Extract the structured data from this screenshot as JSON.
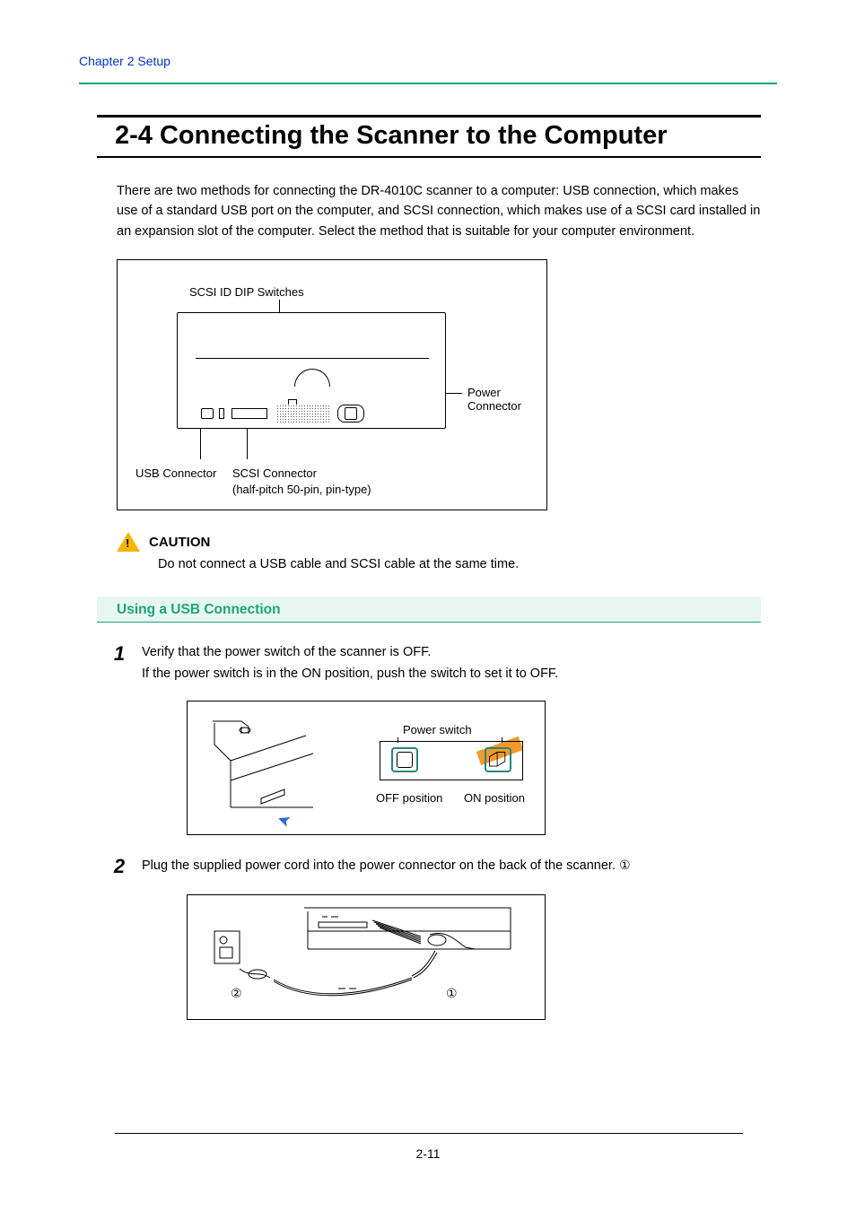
{
  "header": {
    "chapter_link": "Chapter 2   Setup"
  },
  "title": "2-4  Connecting the Scanner to the Computer",
  "intro": "There are two methods for connecting the DR-4010C scanner to a computer: USB connection, which makes use of a standard USB port on the computer, and SCSI connection, which makes use of a SCSI card installed in an expansion slot of the computer. Select the method that is suitable for your computer environment.",
  "figure1": {
    "scsi_dip_label": "SCSI ID DIP Switches",
    "power_connector_label": "Power Connector",
    "usb_connector_label": "USB Connector",
    "scsi_connector_label": "SCSI Connector",
    "scsi_connector_sub": "(half-pitch 50-pin, pin-type)"
  },
  "caution": {
    "title": "CAUTION",
    "text": "Do not connect a USB cable and SCSI cable at the same time."
  },
  "subheading": "Using a USB Connection",
  "steps": [
    {
      "num": "1",
      "line1": "Verify that the power switch of the scanner is OFF.",
      "line2": "If the power switch is in the ON position, push the switch to set it to OFF."
    },
    {
      "num": "2",
      "line1": "Plug the supplied power cord into the power connector on the back of the scanner. ",
      "ref": "①"
    }
  ],
  "figure2": {
    "power_switch_label": "Power switch",
    "off_label": "OFF position",
    "on_label": "ON position"
  },
  "figure3": {
    "ref1": "①",
    "ref2": "②"
  },
  "page_number": "2-11"
}
